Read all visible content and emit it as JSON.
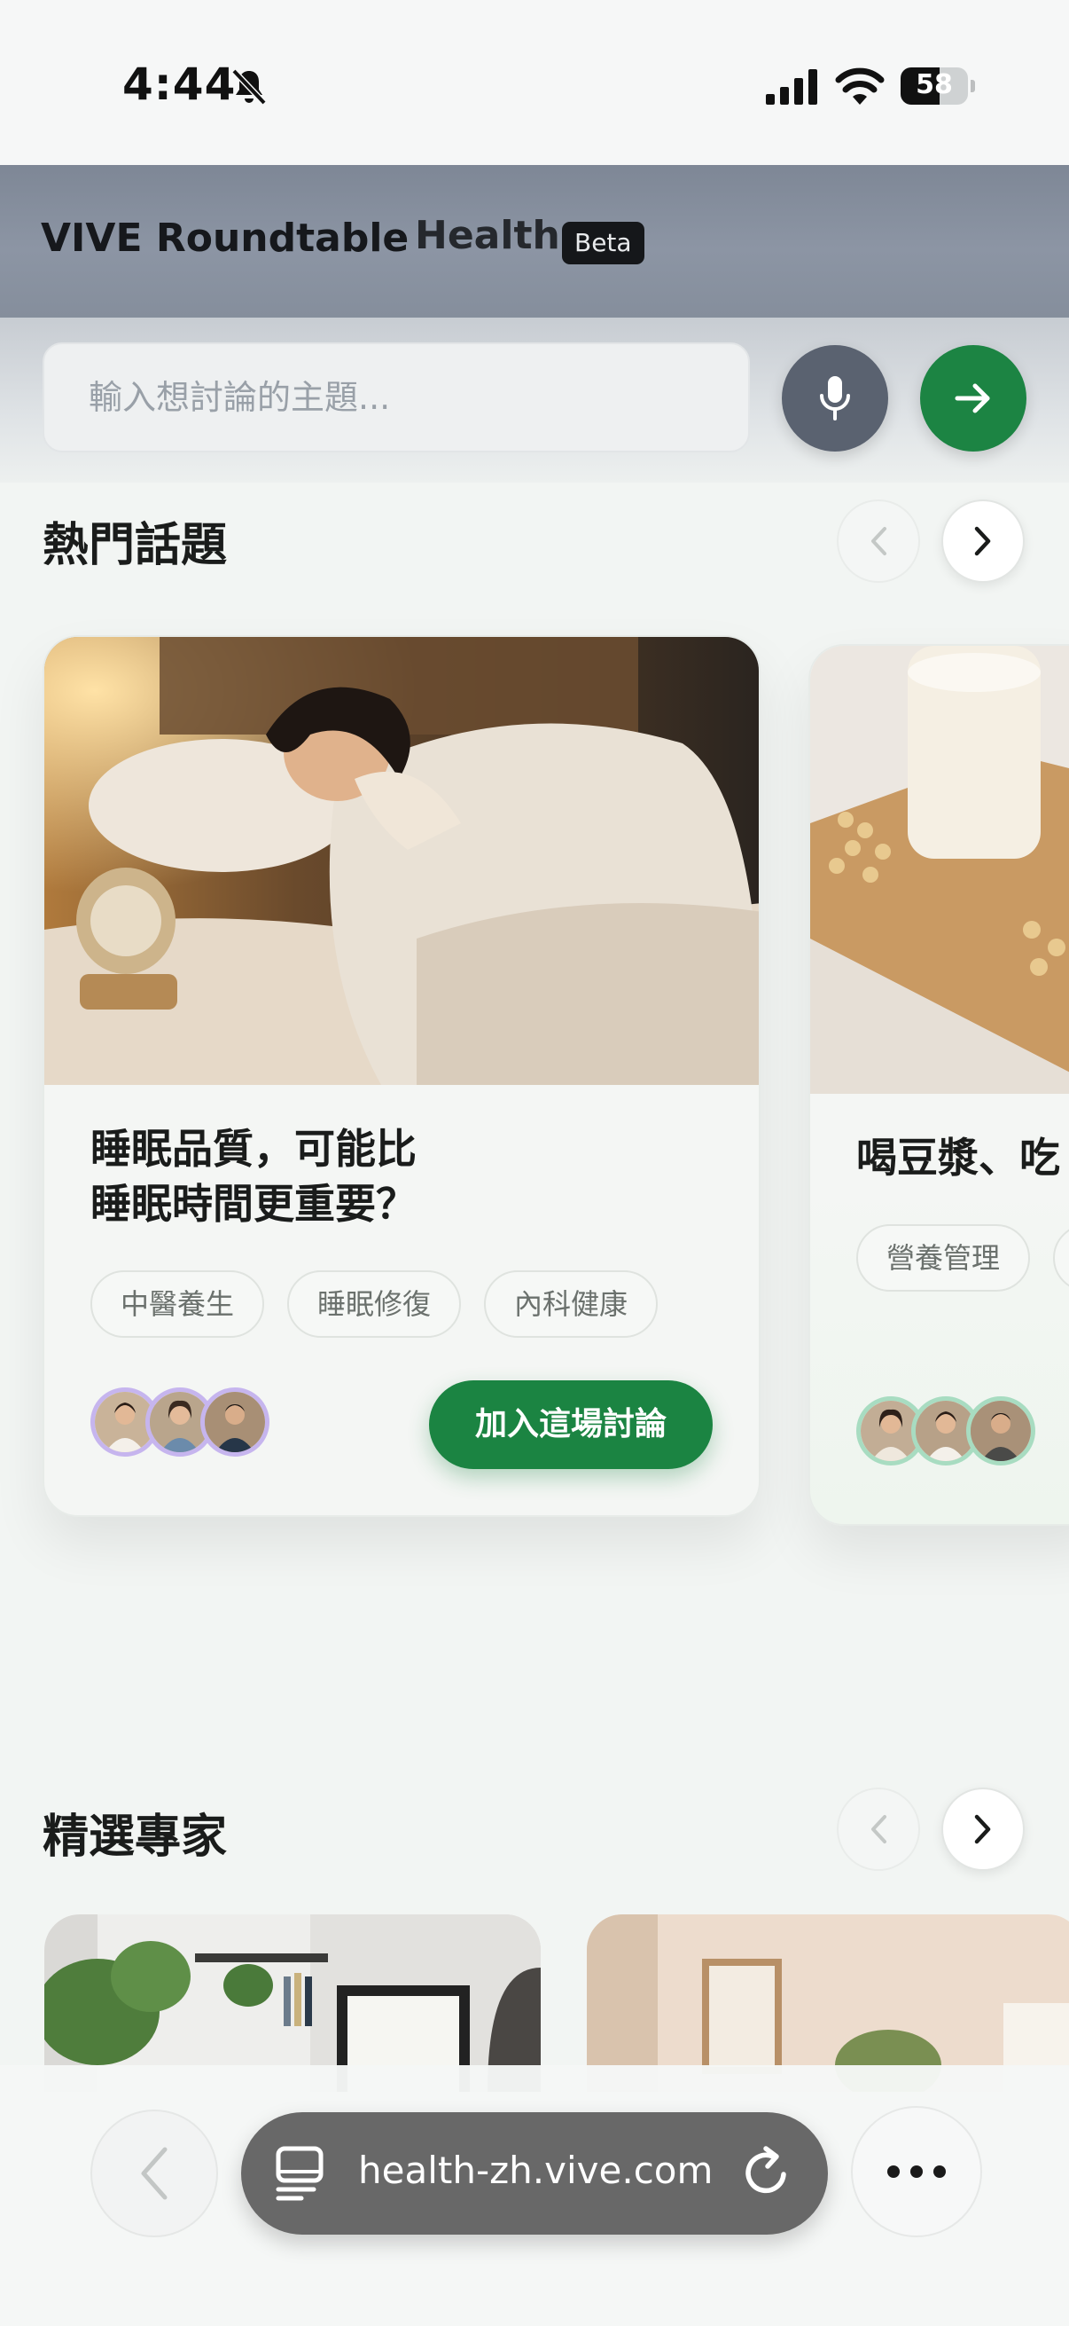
{
  "status_bar": {
    "time": "4:44",
    "battery_level": "58",
    "icons": [
      "bell-slash-icon",
      "cellular-signal-icon",
      "wifi-icon",
      "battery-icon"
    ]
  },
  "header": {
    "brand": "VIVE Roundtable",
    "brand_sub": "Health",
    "badge": "Beta"
  },
  "search": {
    "placeholder": "輸入想討論的主題...",
    "value": "",
    "icons": [
      "microphone-icon",
      "arrow-right-icon"
    ]
  },
  "hot_topics": {
    "title": "熱門話題",
    "cards": [
      {
        "title_line1": "睡眠品質，可能比",
        "title_line2": "睡眠時間更重要？",
        "tags": [
          "中醫養生",
          "睡眠修復",
          "內科健康"
        ],
        "button": "加入這場討論"
      },
      {
        "title_line1": "喝豆漿、吃",
        "tags": [
          "營養管理"
        ]
      }
    ]
  },
  "experts": {
    "title": "精選專家"
  },
  "browser": {
    "url": "health-zh.vive.com",
    "icons": [
      "chevron-left-icon",
      "tab-overview-icon",
      "reload-icon",
      "more-horizontal-icon"
    ]
  },
  "colors": {
    "accent_green": "#1b8442",
    "header_gray": "#858e9c",
    "avatar_ring_purple": "#c6b5ee",
    "avatar_ring_green": "#a8dcc1"
  }
}
